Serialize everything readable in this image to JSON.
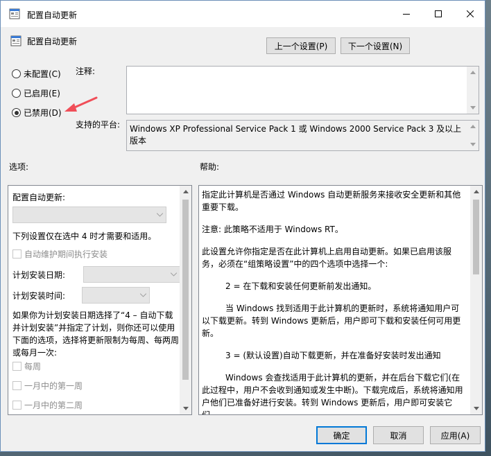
{
  "window": {
    "title": "配置自动更新",
    "header_title": "配置自动更新",
    "prev_button": "上一个设置(P)",
    "next_button": "下一个设置(N)"
  },
  "state": {
    "options": [
      {
        "label": "未配置(C)",
        "selected": false
      },
      {
        "label": "已启用(E)",
        "selected": false
      },
      {
        "label": "已禁用(D)",
        "selected": true
      }
    ]
  },
  "comment": {
    "label": "注释:",
    "value": ""
  },
  "platform": {
    "label": "支持的平台:",
    "value": "Windows XP Professional Service Pack 1 或 Windows 2000 Service Pack 3 及以上版本"
  },
  "options_section": {
    "label": "选项:",
    "configure_label": "配置自动更新:",
    "note": "下列设置仅在选中 4 时才需要和适用。",
    "maintenance_check": "自动维护期间执行安装",
    "schedule_day_label": "计划安装日期:",
    "schedule_time_label": "计划安装时间:",
    "explain": "如果你为计划安装日期选择了“4 – 自动下载并计划安装”并指定了计划，则你还可以使用下面的选项，选择将更新限制为每周、每两周或每月一次:",
    "weekly": "每周",
    "first_week": "一月中的第一周",
    "second_week": "一月中的第二周"
  },
  "help_section": {
    "label": "帮助:",
    "p1": "指定此计算机是否通过 Windows 自动更新服务来接收安全更新和其他重要下载。",
    "p2": "注意: 此策略不适用于 Windows RT。",
    "p3": "此设置允许你指定是否在此计算机上启用自动更新。如果已启用该服务，必须在“组策略设置”中的四个选项中选择一个:",
    "p4": "2 = 在下载和安装任何更新前发出通知。",
    "p5": "当 Windows 找到适用于此计算机的更新时，系统将通知用户可以下载更新。转到 Windows 更新后，用户即可下载和安装任何可用更新。",
    "p6": "3 = (默认设置)自动下载更新，并在准备好安装时发出通知",
    "p7": "Windows 会查找适用于此计算机的更新，并在后台下载它们(在此过程中，用户不会收到通知或发生中断)。下载完成后，系统将通知用户他们已准备好进行安装。转到 Windows 更新后，用户即可安装它们。"
  },
  "footer": {
    "ok": "确定",
    "cancel": "取消",
    "apply": "应用(A)"
  },
  "colors": {
    "accent": "#0078d7",
    "arrow": "#f04e58"
  }
}
